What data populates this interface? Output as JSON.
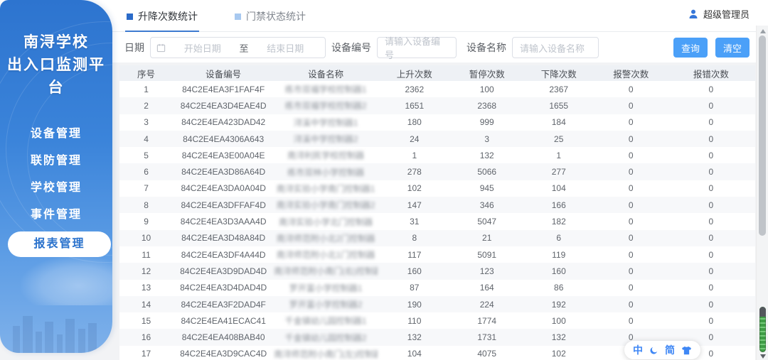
{
  "sidebar": {
    "title_line1": "南浔学校",
    "title_line2": "出入口监测平台",
    "items": [
      {
        "label": "设备管理",
        "active": false
      },
      {
        "label": "联防管理",
        "active": false
      },
      {
        "label": "学校管理",
        "active": false
      },
      {
        "label": "事件管理",
        "active": false
      },
      {
        "label": "报表管理",
        "active": true
      }
    ]
  },
  "header": {
    "user_name": "超级管理员",
    "tabs": [
      {
        "label": "升降次数统计",
        "active": true
      },
      {
        "label": "门禁状态统计",
        "active": false
      }
    ]
  },
  "filters": {
    "date_label": "日期",
    "start_placeholder": "开始日期",
    "range_separator": "至",
    "end_placeholder": "结束日期",
    "device_no_label": "设备编号",
    "device_no_placeholder": "请输入设备编号",
    "device_name_label": "设备名称",
    "device_name_placeholder": "请输入设备名称",
    "search_button": "查询",
    "clear_button": "清空"
  },
  "table": {
    "columns": [
      "序号",
      "设备编号",
      "设备名称",
      "上升次数",
      "暂停次数",
      "下降次数",
      "报警次数",
      "报错次数"
    ],
    "names_obscured": true,
    "rows": [
      [
        "1",
        "84C2E4EA3F1FAF4F",
        "练市双福学校控制器1",
        "2362",
        "100",
        "2367",
        "0",
        "0"
      ],
      [
        "2",
        "84C2E4EA3D4EAE4D",
        "练市双福学校控制器2",
        "1651",
        "2368",
        "1655",
        "0",
        "0"
      ],
      [
        "3",
        "84C2E4EA423DAD42",
        "浔溪中学控制器1",
        "180",
        "999",
        "184",
        "0",
        "0"
      ],
      [
        "4",
        "84C2E4EA4306A643",
        "浔溪中学控制器2",
        "24",
        "3",
        "25",
        "0",
        "0"
      ],
      [
        "5",
        "84C2E4EA3E00A04E",
        "南浔利民学校控制器",
        "1",
        "132",
        "1",
        "0",
        "0"
      ],
      [
        "6",
        "84C2E4EA3D86A64D",
        "练市双林小学控制器",
        "278",
        "5066",
        "277",
        "0",
        "0"
      ],
      [
        "7",
        "84C2E4EA3DA0A04D",
        "南浔实验小学南门控制器1",
        "102",
        "945",
        "104",
        "0",
        "0"
      ],
      [
        "8",
        "84C2E4EA3DFFAF4D",
        "南浔实验小学南门控制器2",
        "147",
        "346",
        "166",
        "0",
        "0"
      ],
      [
        "9",
        "84C2E4EA3D3AAA4D",
        "南浔实验小学北门控制器",
        "31",
        "5047",
        "182",
        "0",
        "0"
      ],
      [
        "10",
        "84C2E4EA3D48A84D",
        "南浔师范附小北2门控制器",
        "8",
        "21",
        "6",
        "0",
        "0"
      ],
      [
        "11",
        "84C2E4EA3DF4A44D",
        "南浔师范附小北1门控制器",
        "117",
        "5091",
        "119",
        "0",
        "0"
      ],
      [
        "12",
        "84C2E4EA3D9DAD4D",
        "南浔师范附小南门(右)控制器1",
        "160",
        "123",
        "160",
        "0",
        "0"
      ],
      [
        "13",
        "84C2E4EA3D4DAD4D",
        "罗开富小学控制器1",
        "87",
        "164",
        "86",
        "0",
        "0"
      ],
      [
        "14",
        "84C2E4EA3F2DAD4F",
        "罗开富小学控制器2",
        "190",
        "224",
        "192",
        "0",
        "0"
      ],
      [
        "15",
        "84C2E4EA41ECAC41",
        "千金镇幼儿园控制器1",
        "110",
        "1774",
        "100",
        "0",
        "0"
      ],
      [
        "16",
        "84C2E4EA408BAB40",
        "千金镇幼儿园控制器2",
        "132",
        "1731",
        "132",
        "0",
        "0"
      ],
      [
        "17",
        "84C2E4EA3D9CAC4D",
        "南浔师范附小南门(左)控制器2",
        "104",
        "4075",
        "102",
        "0",
        "0"
      ]
    ]
  },
  "float_widget": {
    "chinese_label": "中",
    "simplified_label": "简"
  },
  "colors": {
    "accent_blue": "#4ba0f8",
    "tab_active_underline": "#3e7bd0",
    "sidebar_gradient_top": "#2d74cf",
    "sidebar_gradient_bottom": "#7fb1ea",
    "active_menu_text": "#2a72cc",
    "header_row_bg": "#eef1f5",
    "zebra_row_bg": "#f7f8fa",
    "scroll_indicator_green": "#3f9d46"
  }
}
